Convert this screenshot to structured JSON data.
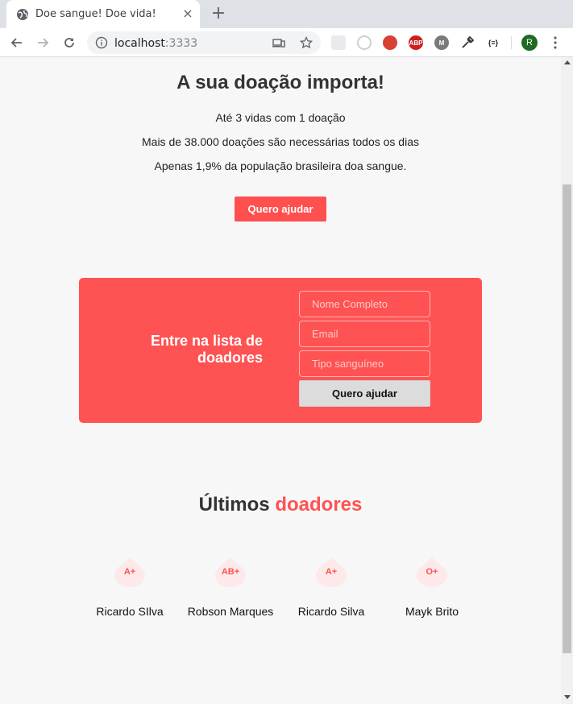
{
  "browser": {
    "tab_title": "Doe sangue! Doe vida!",
    "tab_close": "×",
    "new_tab": "+",
    "url_host": "localhost",
    "url_port": ":3333",
    "profile_initial": "R",
    "extensions": [
      {
        "name": "abp-extension",
        "label": "ABP",
        "color": "#cc1f1f"
      },
      {
        "name": "m-extension",
        "label": "M",
        "color": "#7a7a7a"
      },
      {
        "name": "json-extension",
        "label": "{≡}",
        "color": "#ffffff"
      }
    ]
  },
  "hero": {
    "title": "A sua doação importa!",
    "lines": [
      "Até 3 vidas com 1 doação",
      "Mais de 38.000 doações são necessárias todos os dias",
      "Apenas 1,9% da população brasileira doa sangue."
    ],
    "cta_label": "Quero ajudar"
  },
  "form": {
    "heading": "Entre na lista de doadores",
    "name_placeholder": "Nome Completo",
    "email_placeholder": "Email",
    "blood_placeholder": "Tipo sanguíneo",
    "submit_label": "Quero ajudar"
  },
  "donors_section": {
    "title_prefix": "Últimos",
    "title_accent": "doadores",
    "donors": [
      {
        "blood": "A+",
        "name": "Ricardo SIlva"
      },
      {
        "blood": "AB+",
        "name": "Robson Marques"
      },
      {
        "blood": "A+",
        "name": "Ricardo Silva"
      },
      {
        "blood": "O+",
        "name": "Mayk Brito"
      }
    ]
  },
  "colors": {
    "accent": "#ff5252",
    "background": "#f7f7f7"
  }
}
